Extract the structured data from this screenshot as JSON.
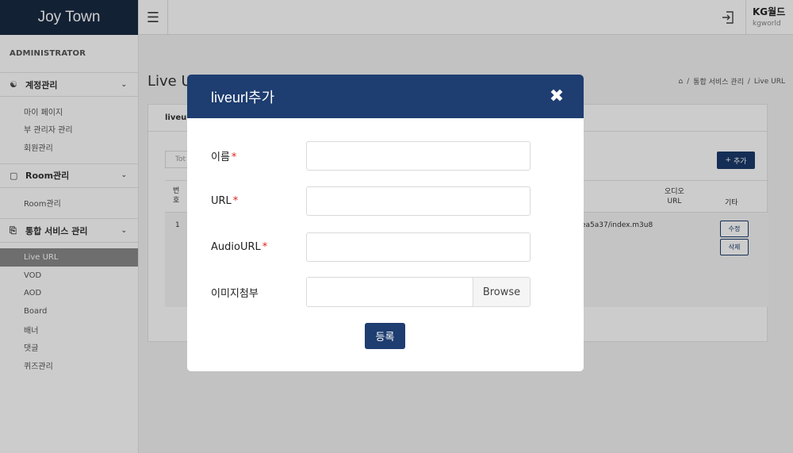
{
  "app": {
    "brand": "Joy Town"
  },
  "header": {
    "user_name": "KG월드",
    "user_id": "kgworld"
  },
  "sidebar": {
    "section_label": "ADMINISTRATOR",
    "groups": [
      {
        "label": "계정관리",
        "items": [
          "마이 페이지",
          "부 관리자 관리",
          "회원관리"
        ]
      },
      {
        "label": "Room관리",
        "items": [
          "Room관리"
        ]
      },
      {
        "label": "통합 서비스 관리",
        "items": [
          "Live URL",
          "VOD",
          "AOD",
          "Board",
          "배너",
          "댓글",
          "퀴즈관리"
        ]
      }
    ],
    "active_item": "Live URL"
  },
  "content": {
    "page_title": "Live URL",
    "breadcrumb": [
      "통합 서비스 관리",
      "Live URL"
    ],
    "panel_tab": "liveurl",
    "total_label": "Tot",
    "add_button": "추가",
    "table": {
      "headers": {
        "no": "번\n호",
        "audio_url": "오디오\nURL",
        "etc": "기타"
      },
      "rows": [
        {
          "no": "1",
          "url_fragment": "ea5a37/index.m3u8",
          "edit": "수정",
          "delete": "삭제"
        }
      ]
    }
  },
  "modal": {
    "title": "liveurl추가",
    "fields": [
      {
        "label": "이름",
        "required": true,
        "value": ""
      },
      {
        "label": "URL",
        "required": true,
        "value": ""
      },
      {
        "label": "AudioURL",
        "required": true,
        "value": ""
      },
      {
        "label": "이미지첨부",
        "required": false,
        "browse_label": "Browse"
      }
    ],
    "required_mark": "*",
    "submit_label": "등록"
  },
  "colors": {
    "brand_bg": "#182a43",
    "modal_header": "#1e3d70",
    "required": "#e2231a",
    "active_menu": "#8a8a8a"
  }
}
